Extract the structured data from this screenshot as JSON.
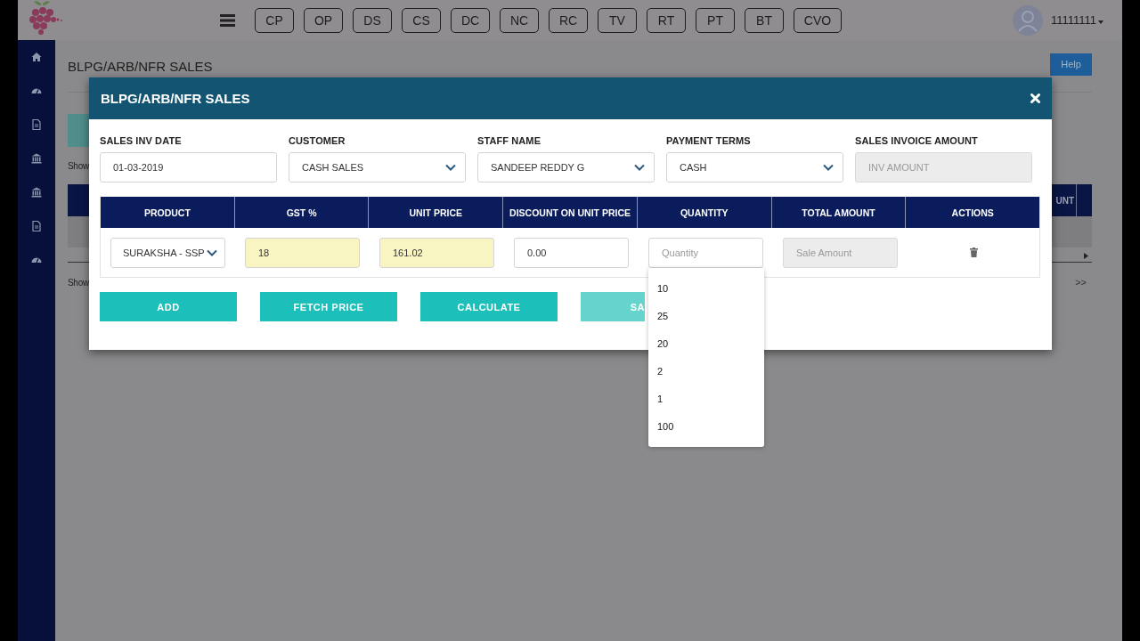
{
  "header": {
    "nav_buttons": [
      "CP",
      "OP",
      "DS",
      "CS",
      "DC",
      "NC",
      "RC",
      "TV",
      "RT",
      "PT",
      "BT",
      "CVO"
    ],
    "user": "11111111"
  },
  "sidebar": {
    "items": [
      {
        "kind": "home"
      },
      {
        "kind": "gauge"
      },
      {
        "kind": "doc"
      },
      {
        "kind": "bank"
      },
      {
        "kind": "bank"
      },
      {
        "kind": "doc"
      },
      {
        "kind": "gauge"
      }
    ]
  },
  "page": {
    "title": "BLPG/ARB/NFR SALES",
    "help_button": "Help",
    "show_labels": [
      "Show",
      "Show"
    ],
    "column_cut": "UNT",
    "pager_next": ">>"
  },
  "modal": {
    "title": "BLPG/ARB/NFR SALES",
    "fields": [
      {
        "label": "SALES INV DATE",
        "kind": "text",
        "value": "01-03-2019",
        "disabled": false
      },
      {
        "label": "CUSTOMER",
        "kind": "select",
        "value": "CASH SALES",
        "disabled": false
      },
      {
        "label": "STAFF NAME",
        "kind": "select",
        "value": "SANDEEP REDDY G",
        "disabled": false
      },
      {
        "label": "PAYMENT TERMS",
        "kind": "select",
        "value": "CASH",
        "disabled": false
      },
      {
        "label": "SALES INVOICE AMOUNT",
        "kind": "text",
        "placeholder": "INV AMOUNT",
        "disabled": true
      }
    ],
    "table": {
      "columns": [
        "PRODUCT",
        "GST %",
        "UNIT PRICE",
        "DISCOUNT ON UNIT PRICE",
        "QUANTITY",
        "TOTAL AMOUNT",
        "ACTIONS"
      ],
      "rows": [
        {
          "cells": [
            {
              "kind": "select",
              "value": "SURAKSHA - SSP"
            },
            {
              "kind": "input",
              "value": "18",
              "highlighted": true,
              "disabled": false
            },
            {
              "kind": "input",
              "value": "161.02",
              "highlighted": true,
              "disabled": false
            },
            {
              "kind": "input",
              "value": "0.00",
              "highlighted": false,
              "disabled": false
            },
            {
              "kind": "input",
              "placeholder": "Quantity",
              "highlighted": false,
              "disabled": false
            },
            {
              "kind": "input",
              "placeholder": "Sale Amount",
              "highlighted": false,
              "disabled": true
            },
            {
              "kind": "delete"
            }
          ]
        }
      ]
    },
    "buttons": [
      {
        "label": "ADD",
        "disabled": false
      },
      {
        "label": "FETCH PRICE",
        "disabled": false
      },
      {
        "label": "CALCULATE",
        "disabled": false
      },
      {
        "label": "SA",
        "disabled": true
      }
    ],
    "suggestions": [
      "10",
      "25",
      "20",
      "2",
      "1",
      "100"
    ]
  }
}
